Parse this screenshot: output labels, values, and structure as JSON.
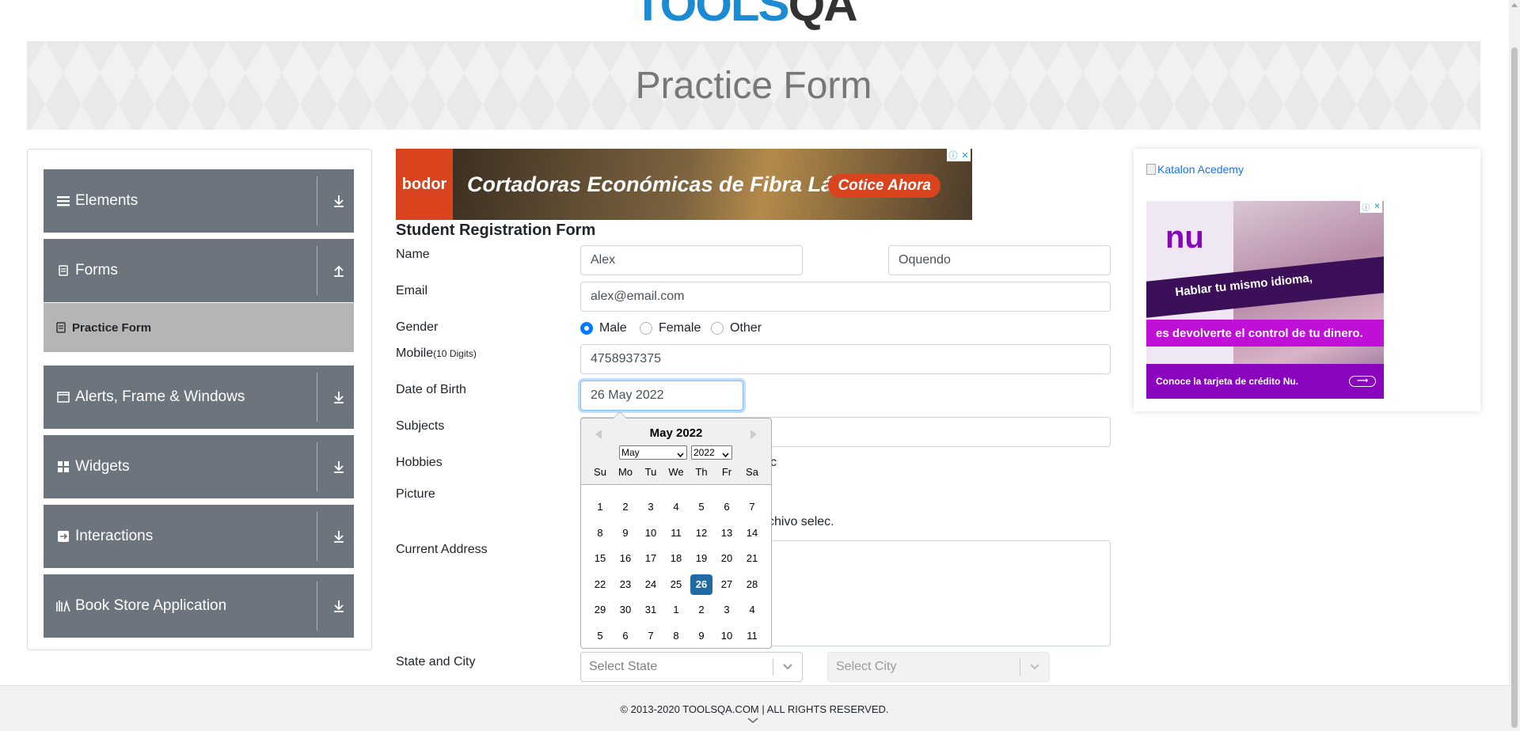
{
  "logo": {
    "text_a": "TOOLS",
    "text_b": "QA"
  },
  "banner": {
    "title": "Practice Form"
  },
  "sidebar": {
    "groups": [
      {
        "label": "Elements",
        "icon": "list-icon",
        "arrow": "download-arrow-icon"
      },
      {
        "label": "Forms",
        "icon": "document-icon",
        "arrow": "upload-arrow-icon"
      },
      {
        "label": "Alerts, Frame & Windows",
        "icon": "window-icon",
        "arrow": "download-arrow-icon"
      },
      {
        "label": "Widgets",
        "icon": "widgets-icon",
        "arrow": "download-arrow-icon"
      },
      {
        "label": "Interactions",
        "icon": "interactions-icon",
        "arrow": "download-arrow-icon"
      },
      {
        "label": "Book Store Application",
        "icon": "books-icon",
        "arrow": "download-arrow-icon"
      }
    ],
    "active_item": {
      "label": "Practice Form"
    }
  },
  "ad_top": {
    "brand": "bodor",
    "headline": "Cortadoras Económicas de Fibra Láser",
    "cta": "Cotice Ahora"
  },
  "form": {
    "title": "Student Registration Form",
    "name_label": "Name",
    "first_name": "Alex",
    "last_name": "Oquendo",
    "email_label": "Email",
    "email": "alex@email.com",
    "gender_label": "Gender",
    "genders": [
      {
        "label": "Male",
        "checked": true
      },
      {
        "label": "Female",
        "checked": false
      },
      {
        "label": "Other",
        "checked": false
      }
    ],
    "mobile_label": "Mobile",
    "mobile_hint": "(10 Digits)",
    "mobile": "4758937375",
    "dob_label": "Date of Birth",
    "dob": "26 May 2022",
    "subjects_label": "Subjects",
    "hobbies_label": "Hobbies",
    "hobbies_partial": "c",
    "picture_label": "Picture",
    "picture_partial": "chivo selec.",
    "address_label": "Current Address",
    "state_city_label": "State and City",
    "state_placeholder": "Select State",
    "city_placeholder": "Select City"
  },
  "datepicker": {
    "title": "May 2022",
    "month_select": "May",
    "year_select": "2022",
    "weekdays": [
      "Su",
      "Mo",
      "Tu",
      "We",
      "Th",
      "Fr",
      "Sa"
    ],
    "weeks": [
      [
        "1",
        "2",
        "3",
        "4",
        "5",
        "6",
        "7"
      ],
      [
        "8",
        "9",
        "10",
        "11",
        "12",
        "13",
        "14"
      ],
      [
        "15",
        "16",
        "17",
        "18",
        "19",
        "20",
        "21"
      ],
      [
        "22",
        "23",
        "24",
        "25",
        "26",
        "27",
        "28"
      ],
      [
        "29",
        "30",
        "31",
        "1",
        "2",
        "3",
        "4"
      ],
      [
        "5",
        "6",
        "7",
        "8",
        "9",
        "10",
        "11"
      ]
    ],
    "selected": "26"
  },
  "ad_right": {
    "alt_text": "Katalon Acedemy",
    "nu_logo": "nu",
    "line1": "Hablar tu mismo idioma,",
    "line2": "es devolverte el control de tu dinero.",
    "line3": "Conoce la tarjeta de crédito Nu."
  },
  "footer": {
    "text": "© 2013-2020 TOOLSQA.COM | ALL RIGHTS RESERVED."
  },
  "colors": {
    "sidebar": "#6c757d",
    "active_item": "#b5b5b5",
    "selected_day": "#216ba5",
    "focus": "#80bdff"
  }
}
